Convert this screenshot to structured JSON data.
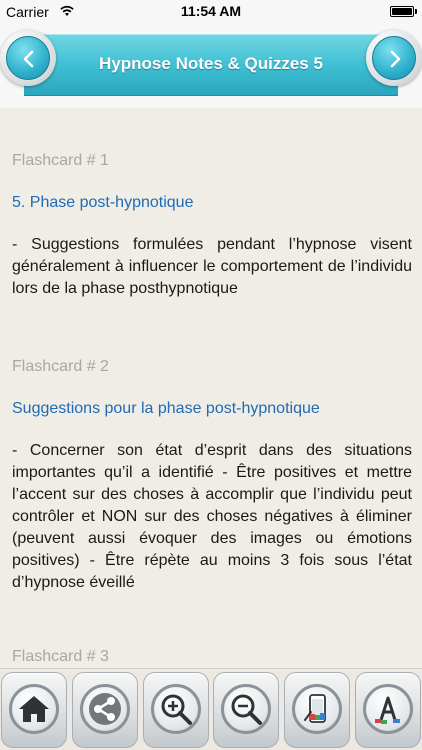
{
  "status_bar": {
    "carrier": "Carrier",
    "time": "11:54 AM"
  },
  "header": {
    "title": "Hypnose Notes & Quizzes 5",
    "prev_icon": "chevron-left-icon",
    "next_icon": "chevron-right-icon",
    "accent_color": "#3fc0d4"
  },
  "cards": [
    {
      "label": "Flashcard # 1",
      "heading": "5. Phase post-hypnotique",
      "body": "- Suggestions formulées pendant l’hypnose visent généralement à influencer le comportement de l’individu lors de la phase posthypnotique"
    },
    {
      "label": "Flashcard # 2",
      "heading": "Suggestions pour la phase post-hypnotique",
      "body": "- Concerner son état d’esprit dans des situations importantes qu’il a identifié - Être positives et mettre l’accent sur des choses à accomplir que l’individu peut contrôler et NON sur des choses négatives à éliminer (peuvent aussi évoquer des images ou émotions positives) - Être répète au moins 3 fois sous l’état d’hypnose éveillé"
    },
    {
      "label": "Flashcard # 3"
    }
  ],
  "colors": {
    "label": "#a7a7a7",
    "heading": "#1f6bb5",
    "body": "#1a1a1a",
    "background": "#efede6"
  },
  "toolbar": {
    "buttons": [
      {
        "icon": "home-icon"
      },
      {
        "icon": "share-icon"
      },
      {
        "icon": "zoom-in-icon"
      },
      {
        "icon": "zoom-out-icon"
      },
      {
        "icon": "phone-theme-icon"
      },
      {
        "icon": "font-icon"
      }
    ]
  }
}
